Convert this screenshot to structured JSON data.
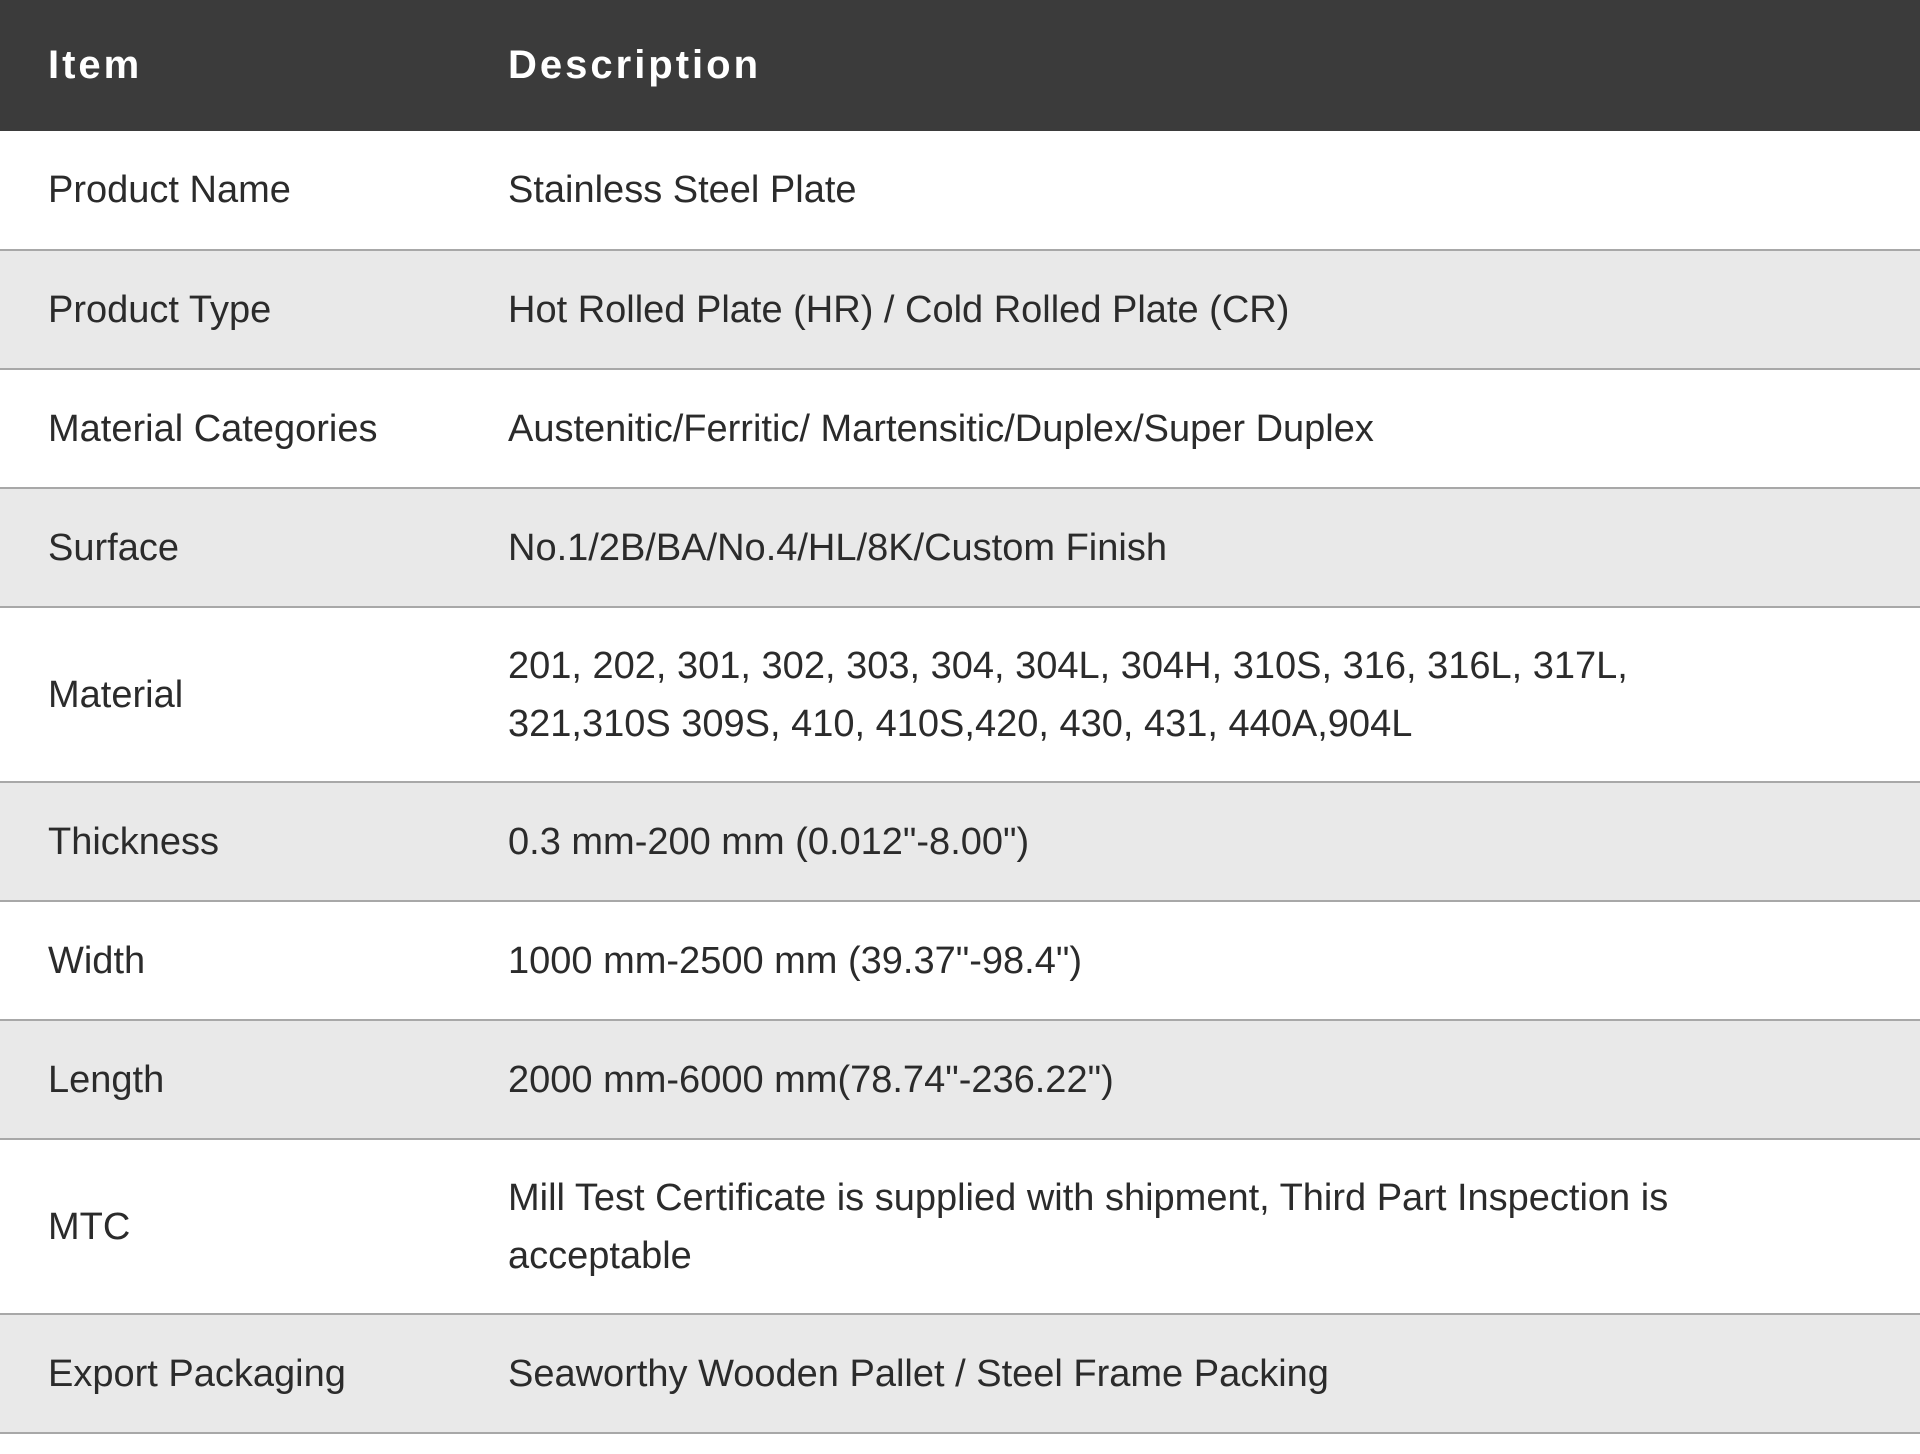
{
  "table": {
    "headers": {
      "item": "Item",
      "description": "Description"
    },
    "rows": [
      {
        "item": "Product Name",
        "description": "Stainless Steel Plate"
      },
      {
        "item": "Product Type",
        "description": "Hot Rolled Plate (HR) / Cold Rolled Plate (CR)"
      },
      {
        "item": "Material Categories",
        "description": "Austenitic/Ferritic/ Martensitic/Duplex/Super Duplex"
      },
      {
        "item": "Surface",
        "description": "No.1/2B/BA/No.4/HL/8K/Custom Finish"
      },
      {
        "item": "Material",
        "description": "201, 202, 301, 302, 303, 304, 304L, 304H, 310S, 316, 316L, 317L, 321,310S 309S, 410, 410S,420, 430, 431, 440A,904L"
      },
      {
        "item": "Thickness",
        "description": "0.3 mm-200 mm (0.012\"-8.00\")"
      },
      {
        "item": "Width",
        "description": "1000 mm-2500 mm (39.37\"-98.4\")"
      },
      {
        "item": "Length",
        "description": "2000 mm-6000 mm(78.74\"-236.22\")"
      },
      {
        "item": "MTC",
        "description": "Mill Test Certificate is supplied with shipment, Third Part Inspection is acceptable"
      },
      {
        "item": "Export Packaging",
        "description": "Seaworthy Wooden Pallet / Steel Frame Packing"
      }
    ]
  },
  "colors": {
    "header_bg": "#3b3b3b",
    "header_text": "#ffffff",
    "row_alt_bg": "#e9e9e9",
    "row_bg": "#ffffff",
    "divider": "#a8a8a8",
    "body_text": "#2b2b2b"
  }
}
